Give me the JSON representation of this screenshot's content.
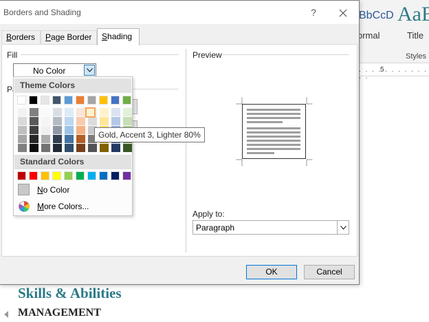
{
  "window": {
    "title": "Borders and Shading",
    "help": "?"
  },
  "tabs": [
    {
      "label": "Borders",
      "underline": "B",
      "rest": "orders"
    },
    {
      "label": "Page Border",
      "underline": "P",
      "rest": "age Border"
    },
    {
      "label": "Shading",
      "underline": "S",
      "rest": "hading",
      "active": true
    }
  ],
  "fill": {
    "label": "Fill",
    "value": "No Color"
  },
  "patterns": {
    "label_fragment": "Pa"
  },
  "color_dropdown": {
    "theme_header": "Theme Colors",
    "standard_header": "Standard Colors",
    "theme_top_row": [
      "#ffffff",
      "#000000",
      "#e7e6e6",
      "#44546a",
      "#5b9bd5",
      "#ed7d31",
      "#a5a5a5",
      "#ffc000",
      "#4472c4",
      "#70ad47"
    ],
    "standard_colors": [
      "#c00000",
      "#ff0000",
      "#ffc000",
      "#ffff00",
      "#92d050",
      "#00b050",
      "#00b0f0",
      "#0070c0",
      "#002060",
      "#7030a0"
    ],
    "no_color": "No Color",
    "no_color_underline": "N",
    "no_color_rest": "o Color",
    "more_colors": "More Colors...",
    "more_colors_underline": "M",
    "more_colors_rest": "ore Colors..."
  },
  "tooltip": "Gold, Accent 3, Lighter 80%",
  "preview": {
    "label": "Preview"
  },
  "apply_to": {
    "label": "Apply to:",
    "value": "Paragraph"
  },
  "buttons": {
    "ok": "OK",
    "cancel": "Cancel"
  },
  "word_background": {
    "style_sample_1": "BbCcD",
    "style_sample_2": "AaE",
    "style_name_1": "ormal",
    "style_name_2": "Title",
    "styles_group": "Styles",
    "ruler_number": "5",
    "heading": "Skills & Abilities",
    "subheading": "MANAGEMENT"
  },
  "colors": {
    "accent_blue": "#0078d7",
    "heading_teal": "#2b7a86",
    "hover_border": "#f4a460"
  }
}
